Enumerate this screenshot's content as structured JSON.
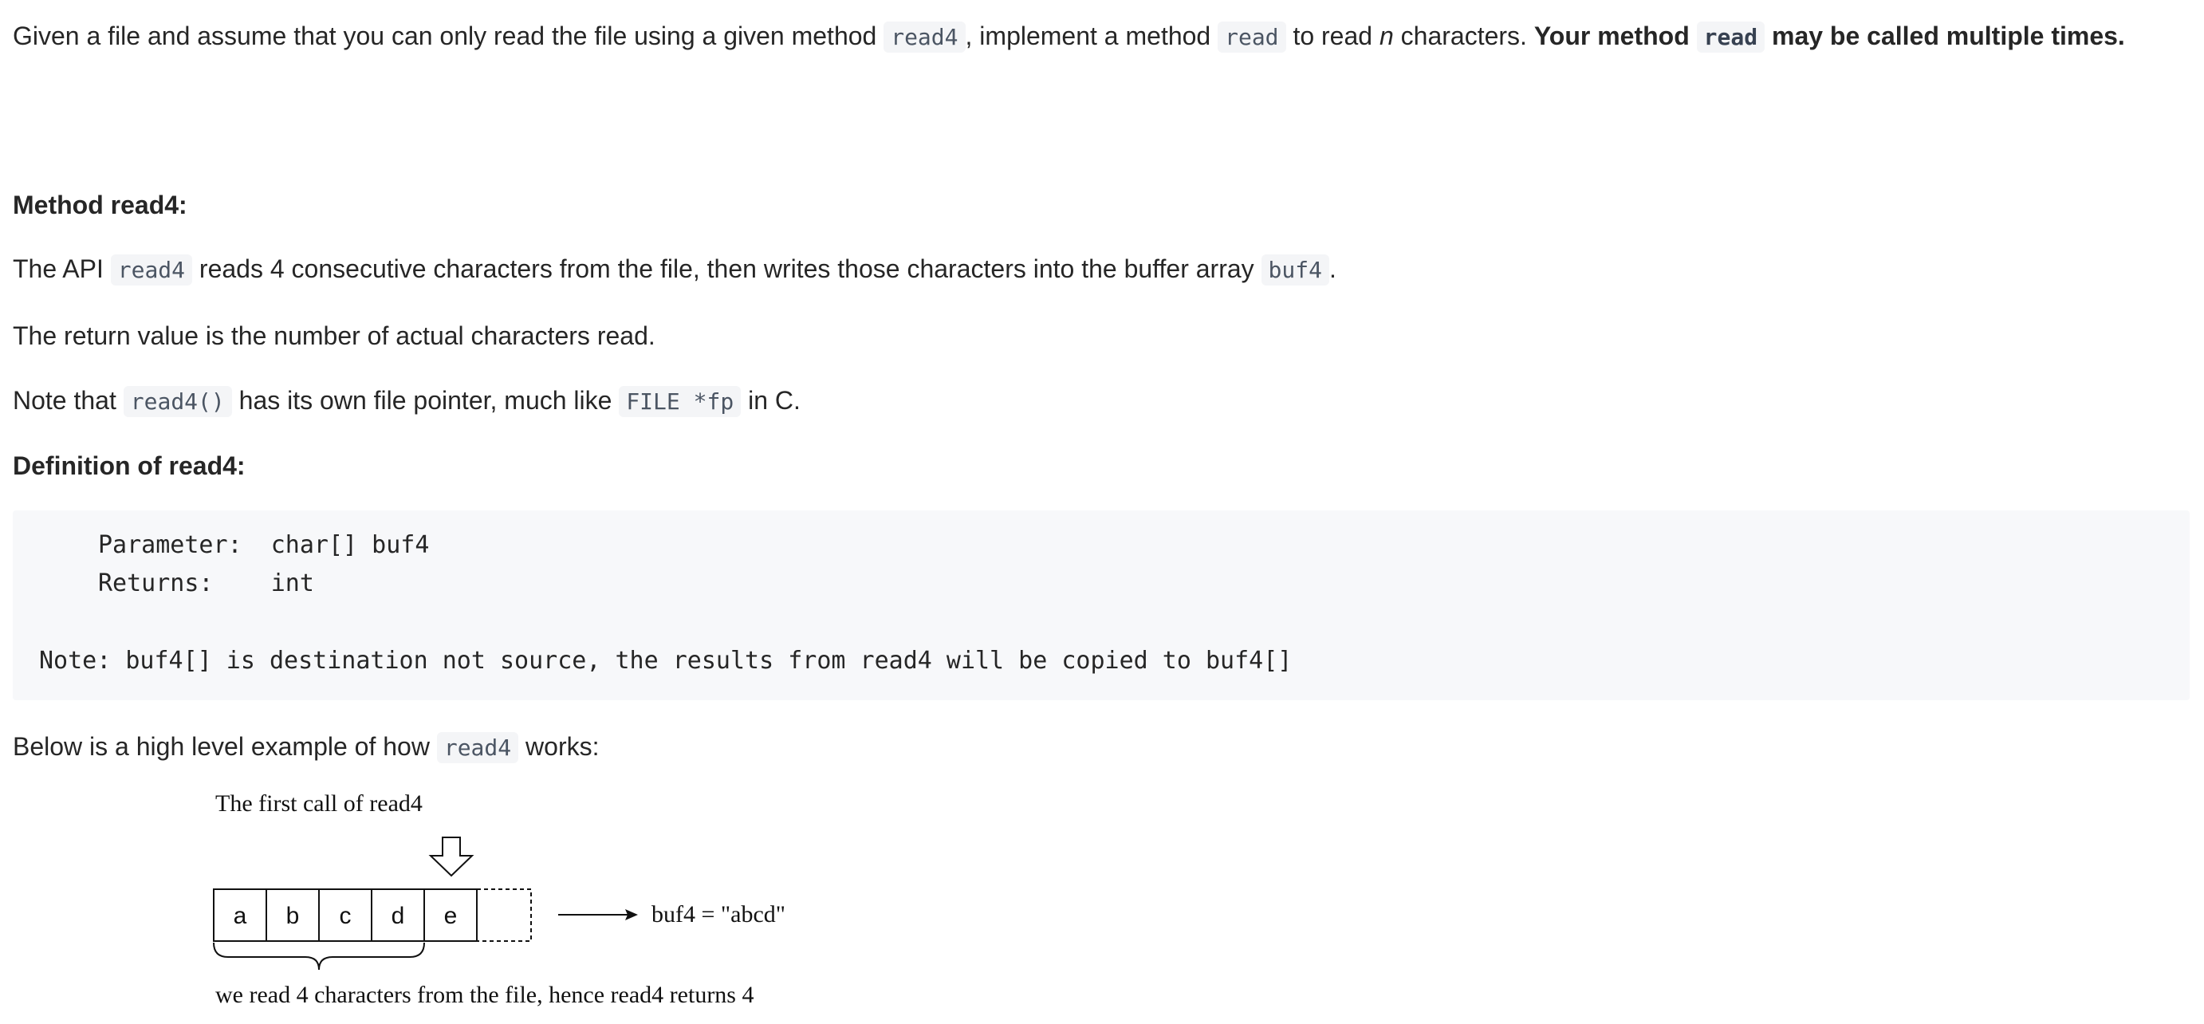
{
  "intro": {
    "text_1": "Given a file and assume that you can only read the file using a given method ",
    "code_read4": "read4",
    "text_2": ", implement a method ",
    "code_read": "read",
    "text_3": " to read ",
    "n": "n",
    "text_4": " characters. ",
    "bold_1": "Your method ",
    "bold_code": "read",
    "bold_2": " may be called multiple times."
  },
  "method_heading": "Method read4:",
  "api_line": {
    "text_1": "The API ",
    "code_1": "read4",
    "text_2": " reads 4 consecutive characters from the file, then writes those characters into the buffer array ",
    "code_2": "buf4",
    "text_3": "."
  },
  "return_line": "The return value is the number of actual characters read.",
  "note_line": {
    "text_1": "Note that ",
    "code_1": "read4()",
    "text_2": " has its own file pointer, much like ",
    "code_2": "FILE *fp",
    "text_3": " in C."
  },
  "definition_heading": "Definition of read4:",
  "code_block": {
    "param_line": "Parameter:  char[] buf4",
    "returns_line": "Returns:    int",
    "note_line": "Note: buf4[] is destination not source, the results from read4 will be copied to buf4[]"
  },
  "example_line": {
    "text_1": "Below is a high level example of how ",
    "code_1": "read4",
    "text_2": " works:"
  },
  "figure": {
    "title": "The first call of read4",
    "cells": [
      "a",
      "b",
      "c",
      "d",
      "e"
    ],
    "result": "buf4 = \"abcd\"",
    "caption": "we read 4 characters from the file, hence read4 returns 4"
  }
}
